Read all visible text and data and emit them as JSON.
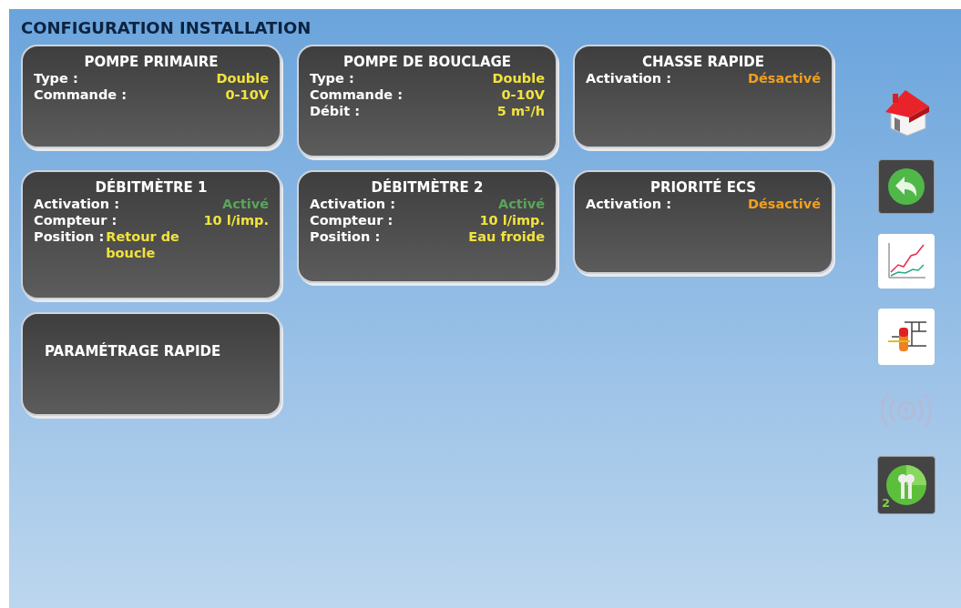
{
  "title": "CONFIGURATION INSTALLATION",
  "cards": [
    {
      "title": "POMPE PRIMAIRE",
      "fields": [
        {
          "label": "Type :",
          "value": "Double",
          "color": "#f2e33c",
          "kind": "right"
        },
        {
          "label": "Commande :",
          "value": "0-10V",
          "color": "#f2e33c",
          "kind": "right"
        }
      ]
    },
    {
      "title": "POMPE DE BOUCLAGE",
      "fields": [
        {
          "label": "Type :",
          "value": "Double",
          "color": "#f2e33c",
          "kind": "right"
        },
        {
          "label": "Commande :",
          "value": "0-10V",
          "color": "#f2e33c",
          "kind": "right"
        },
        {
          "label": "Débit :",
          "value": "5 m³/h",
          "color": "#f2e33c",
          "kind": "right"
        }
      ]
    },
    {
      "title": "CHASSE RAPIDE",
      "fields": [
        {
          "label": "Activation :",
          "value": "Désactivé",
          "color": "#f0a020",
          "kind": "right"
        }
      ]
    },
    {
      "title": "DÉBITMÈTRE 1",
      "fields": [
        {
          "label": "Activation :",
          "value": "Activé",
          "color": "#5aa55a",
          "kind": "right"
        },
        {
          "label": "Compteur :",
          "value": "10 l/imp.",
          "color": "#f2e33c",
          "kind": "right"
        },
        {
          "label": "Position :",
          "value": "Retour de boucle",
          "color": "#f2e33c",
          "kind": "inline"
        }
      ]
    },
    {
      "title": "DÉBITMÈTRE 2",
      "fields": [
        {
          "label": "Activation :",
          "value": "Activé",
          "color": "#5aa55a",
          "kind": "right"
        },
        {
          "label": "Compteur :",
          "value": "10 l/imp.",
          "color": "#f2e33c",
          "kind": "right"
        },
        {
          "label": "Position :",
          "value": "Eau froide",
          "color": "#f2e33c",
          "kind": "right"
        }
      ]
    },
    {
      "title": "PRIORITÉ ECS",
      "fields": [
        {
          "label": "Activation :",
          "value": "Désactivé",
          "color": "#f0a020",
          "kind": "right"
        }
      ]
    },
    {
      "title": "PARAMÉTRAGE RAPIDE"
    }
  ],
  "sidebar": [
    {
      "kind": "home",
      "disabled": false
    },
    {
      "kind": "back",
      "disabled": false
    },
    {
      "kind": "chart",
      "disabled": false
    },
    {
      "kind": "schema",
      "disabled": false
    },
    {
      "kind": "alarm",
      "disabled": true
    },
    {
      "kind": "keys",
      "disabled": false,
      "badge": "2"
    }
  ]
}
